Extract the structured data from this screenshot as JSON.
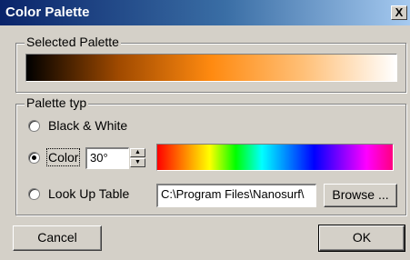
{
  "window": {
    "title": "Color Palette",
    "close_glyph": "X"
  },
  "selected_palette": {
    "group_label": "Selected Palette",
    "gradient_colors": [
      "#000000",
      "#a04a00",
      "#ff8a10",
      "#ffc078",
      "#ffffff"
    ]
  },
  "palette_type": {
    "group_label": "Palette typ",
    "options": [
      {
        "label": "Black & White",
        "selected": false
      },
      {
        "label": "Color",
        "selected": true
      },
      {
        "label": "Look Up Table",
        "selected": false
      }
    ],
    "angle_value": "30°",
    "spectrum_colors": [
      "#ff0000",
      "#ff8000",
      "#ffff00",
      "#00ff00",
      "#00ffff",
      "#0080ff",
      "#0000ff",
      "#8000ff",
      "#ff00ff",
      "#ff0080"
    ],
    "lut_path": "C:\\Program Files\\Nanosurf\\",
    "browse_label": "Browse ..."
  },
  "buttons": {
    "cancel": "Cancel",
    "ok": "OK"
  }
}
